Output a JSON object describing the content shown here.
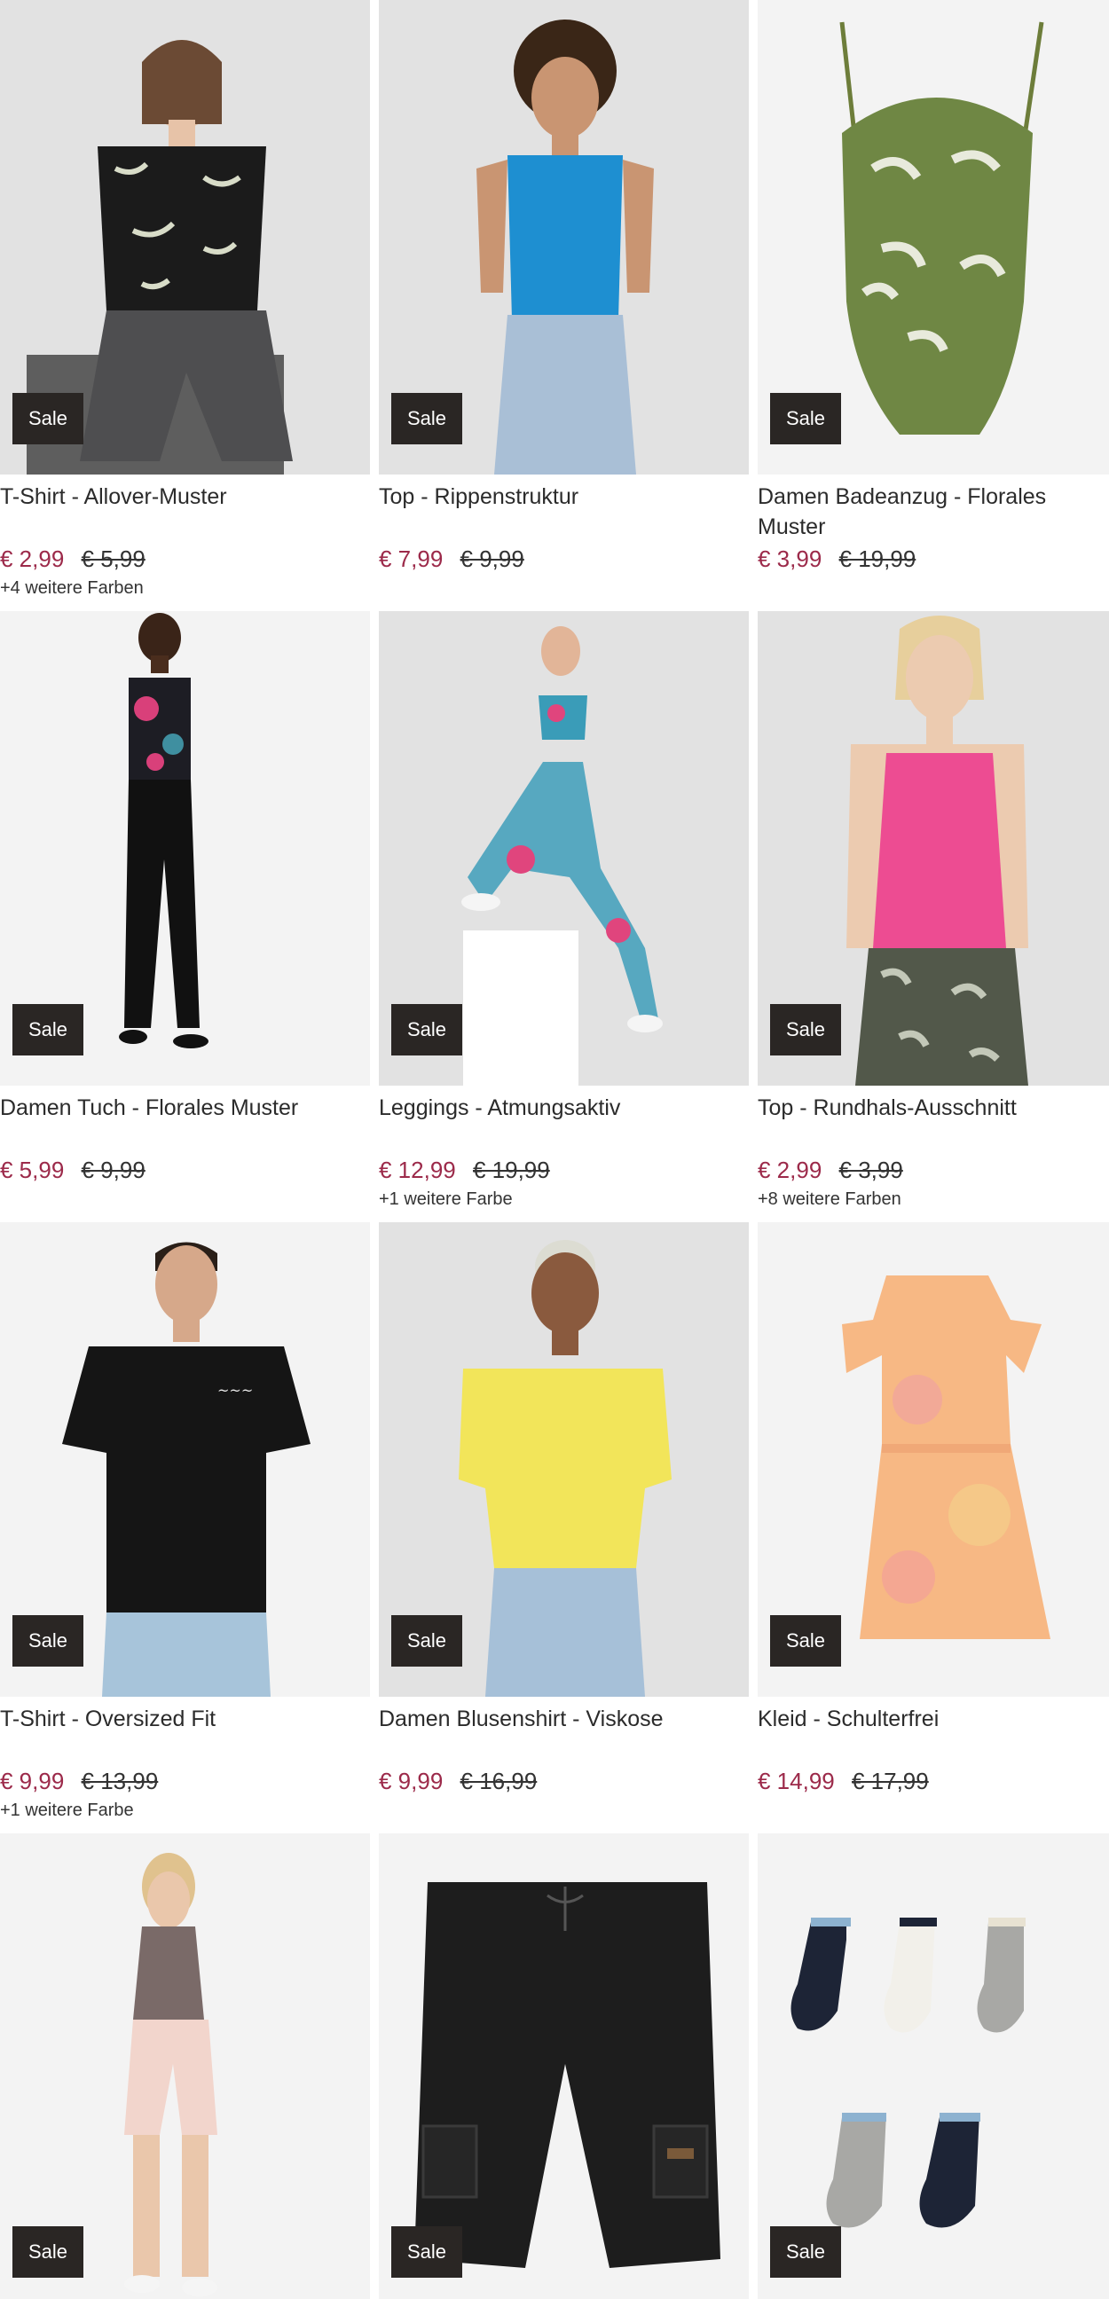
{
  "products": [
    {
      "title": "T-Shirt - Allover-Muster",
      "price": "€ 2,99",
      "old_price": "€ 5,99",
      "colors": "+4 weitere Farben",
      "badge": "Sale"
    },
    {
      "title": "Top - Rippenstruktur",
      "price": "€ 7,99",
      "old_price": "€ 9,99",
      "colors": "",
      "badge": "Sale"
    },
    {
      "title": "Damen Badeanzug - Florales Muster",
      "price": "€ 3,99",
      "old_price": "€ 19,99",
      "colors": "",
      "badge": "Sale"
    },
    {
      "title": "Damen Tuch - Florales Muster",
      "price": "€ 5,99",
      "old_price": "€ 9,99",
      "colors": "",
      "badge": "Sale"
    },
    {
      "title": "Leggings - Atmungsaktiv",
      "price": "€ 12,99",
      "old_price": "€ 19,99",
      "colors": "+1 weitere Farbe",
      "badge": "Sale"
    },
    {
      "title": "Top - Rundhals-Ausschnitt",
      "price": "€ 2,99",
      "old_price": "€ 3,99",
      "colors": "+8 weitere Farben",
      "badge": "Sale"
    },
    {
      "title": "T-Shirt - Oversized Fit",
      "price": "€ 9,99",
      "old_price": "€ 13,99",
      "colors": "+1 weitere Farbe",
      "badge": "Sale"
    },
    {
      "title": "Damen Blusenshirt - Viskose",
      "price": "€ 9,99",
      "old_price": "€ 16,99",
      "colors": "",
      "badge": "Sale"
    },
    {
      "title": "Kleid - Schulterfrei",
      "price": "€ 14,99",
      "old_price": "€ 17,99",
      "colors": "",
      "badge": "Sale"
    },
    {
      "badge": "Sale"
    },
    {
      "badge": "Sale"
    },
    {
      "badge": "Sale"
    }
  ],
  "colors": {
    "sale_price": "#9c2a4a",
    "badge_bg": "#2a2624",
    "image_bg": "#eeeeee"
  }
}
